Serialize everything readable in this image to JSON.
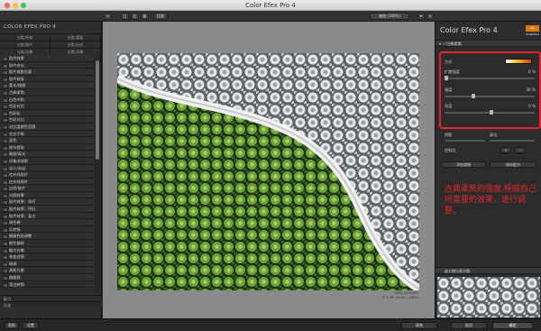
{
  "window": {
    "title": "Color Efex Pro 4"
  },
  "toolbar": {
    "compare_label": "比较",
    "zoom_label": "缩放 (100%)"
  },
  "sidebar": {
    "brand": "COLOR EFEX PRO 4",
    "categories": [
      "分类:所有",
      "分类:喜爱",
      "分类:胶片",
      "分类:历史",
      "分类:风景",
      "分类:风景",
      "分类:肖像",
      "分类:风格"
    ],
    "filters": [
      "胶片效果",
      "胶片老化",
      "胶片电影仿真",
      "胶片修复",
      "柔光/镜腊",
      "古典柔焦",
      "白色中和",
      "色彩对比",
      "色彩化",
      "色彩对比",
      "对比度颜色范围",
      "交叉平衡",
      "双色",
      "细节提取",
      "暗部/高光",
      "印象派效果",
      "淡入/淡出",
      "红外线照片",
      "红外线照片",
      "自然/胶片",
      "光照效果",
      "胶片效果：现代",
      "胶片效果：怀旧",
      "胶片效果：复古",
      "调色棒",
      "反转镜",
      "细微色彩调整",
      "颜色偏移",
      "魅力光晕",
      "渐变滤镜",
      "微调",
      "高斯光晕",
      "偏振镜",
      "黑白转换"
    ],
    "footer": [
      "配方",
      "历史"
    ]
  },
  "photo": {
    "filename": "DSB_0035.JPG",
    "meta": "12.3 MP  (4256 x 2832)"
  },
  "right_panel": {
    "title": "Color Efex Pro",
    "version": "4",
    "logo": "Nik Collection",
    "section_title": "古典柔焦",
    "controls": [
      {
        "label": "方式",
        "value": ""
      },
      {
        "label": "扩散强度",
        "value": "0 %"
      },
      {
        "label": "强度",
        "value": "30 %"
      },
      {
        "label": "亮度",
        "value": "0 %"
      }
    ],
    "strength_value": 0.3,
    "extra": [
      {
        "label": "阴影",
        "value": "0 %"
      },
      {
        "label": "高光",
        "value": "0 %"
      }
    ],
    "control_points_label": "控制点",
    "add_filter_label": "添加滤镜",
    "save_recipe_label": "保存配方",
    "annotation": "古典柔焦的强度,根据自己所需要的效果，进行调整。",
    "loupe_label": "放大镜与直方图"
  },
  "bottom": {
    "help": "帮助",
    "settings": "设置",
    "brush": "画笔",
    "cancel": "取消",
    "ok": "确定"
  }
}
